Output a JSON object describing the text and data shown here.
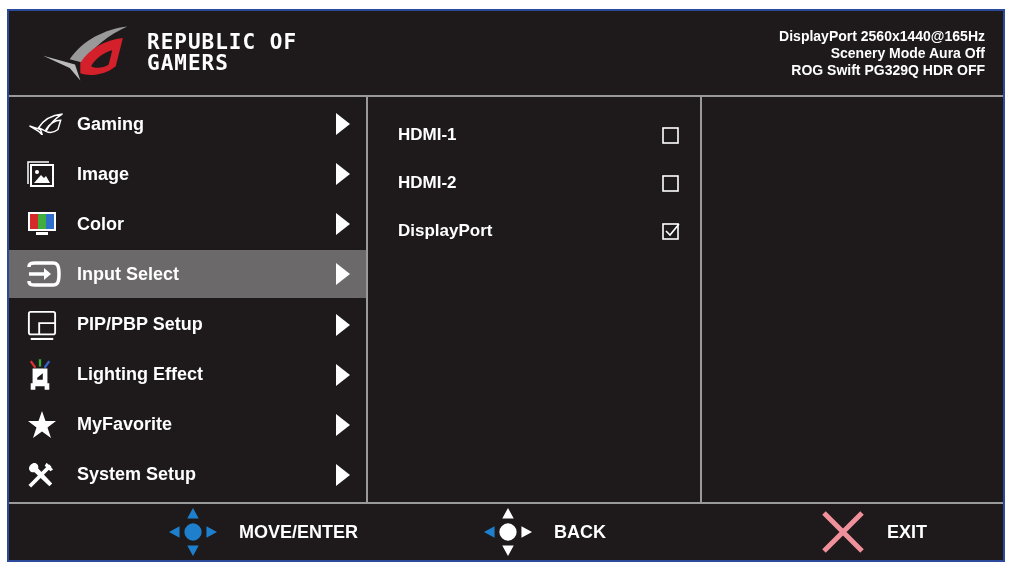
{
  "header": {
    "logo_lines": [
      "REPUBLIC OF",
      "GAMERS"
    ],
    "status_lines": [
      "DisplayPort 2560x1440@165Hz",
      "Scenery Mode Aura Off",
      "ROG Swift PG329Q HDR OFF"
    ]
  },
  "menu": [
    {
      "label": "Gaming",
      "selected": false
    },
    {
      "label": "Image",
      "selected": false
    },
    {
      "label": "Color",
      "selected": false
    },
    {
      "label": "Input Select",
      "selected": true
    },
    {
      "label": "PIP/PBP Setup",
      "selected": false
    },
    {
      "label": "Lighting Effect",
      "selected": false
    },
    {
      "label": "MyFavorite",
      "selected": false
    },
    {
      "label": "System Setup",
      "selected": false
    }
  ],
  "options": [
    {
      "label": "HDMI-1",
      "checked": false
    },
    {
      "label": "HDMI-2",
      "checked": false
    },
    {
      "label": "DisplayPort",
      "checked": true
    }
  ],
  "footer": [
    {
      "kind": "move",
      "label": "MOVE/ENTER"
    },
    {
      "kind": "back",
      "label": "BACK"
    },
    {
      "kind": "exit",
      "label": "EXIT"
    }
  ]
}
